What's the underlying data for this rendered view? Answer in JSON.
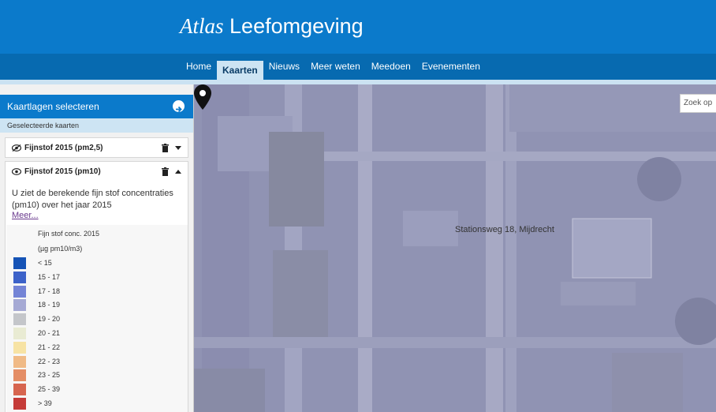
{
  "header": {
    "brand_italic": "Atlas",
    "brand_rest": "Leefomgeving"
  },
  "nav": {
    "items": [
      "Home",
      "Kaarten",
      "Nieuws",
      "Meer weten",
      "Meedoen",
      "Evenementen"
    ],
    "active": "Kaarten"
  },
  "sidebar": {
    "title": "Kaartlagen selecteren",
    "subtitle": "Geselecteerde kaarten",
    "layers": [
      {
        "title": "Fijnstof 2015 (pm2,5)",
        "expanded": false
      },
      {
        "title": "Fijnstof 2015 (pm10)",
        "expanded": true,
        "description": "U ziet de berekende fijn stof concentraties (pm10) over het jaar 2015",
        "more_link": "Meer...",
        "legend": {
          "title": "Fijn stof conc. 2015",
          "unit": "(µg pm10/m3)",
          "items": [
            {
              "label": "< 15",
              "color": "#1553b6"
            },
            {
              "label": "15 - 17",
              "color": "#3c62c9"
            },
            {
              "label": "17 - 18",
              "color": "#7484d6"
            },
            {
              "label": "18 - 19",
              "color": "#a5a9d4"
            },
            {
              "label": "19 - 20",
              "color": "#c4c6ca"
            },
            {
              "label": "20 - 21",
              "color": "#e9ebd3"
            },
            {
              "label": "21 - 22",
              "color": "#f7e3a4"
            },
            {
              "label": "22 - 23",
              "color": "#f0ba86"
            },
            {
              "label": "23 - 25",
              "color": "#e48d65"
            },
            {
              "label": "25 - 39",
              "color": "#d7654f"
            },
            {
              "label": "> 39",
              "color": "#c53b38"
            }
          ]
        }
      }
    ]
  },
  "map": {
    "search_placeholder": "Zoek op",
    "marker_label": "Stationsweg 18, Mijdrecht"
  },
  "colors": {
    "header": "#0b7acb",
    "nav": "#076ab0",
    "map_overlay": "#8f92b4"
  }
}
